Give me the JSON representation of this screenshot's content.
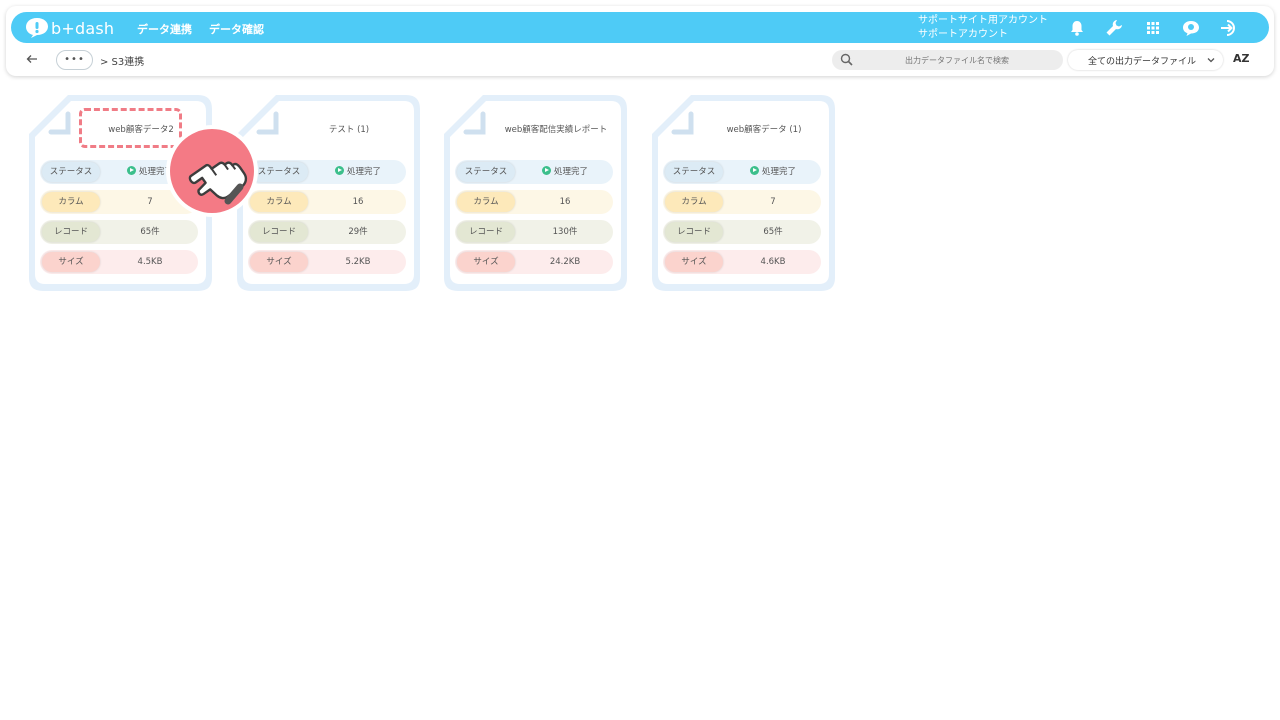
{
  "app": {
    "logo_text": "b+dash"
  },
  "nav": {
    "items": [
      "データ連携",
      "データ確認"
    ]
  },
  "account": {
    "line1": "サポートサイト用アカウント",
    "line2": "サポートアカウント"
  },
  "icons": {
    "bell": "bell-icon",
    "tool": "wrench-icon",
    "apps": "grid-icon",
    "user": "user-avatar-icon",
    "logout": "logout-icon",
    "back": "arrow-left-icon",
    "search": "search-icon",
    "chevron": "chevron-down-icon"
  },
  "breadcrumb": {
    "dots": "•••",
    "path": "> S3連携"
  },
  "search": {
    "placeholder": "出力データファイル名で検索"
  },
  "filter": {
    "selected": "全ての出力データファイル"
  },
  "sort": {
    "label": "AZ"
  },
  "row_labels": {
    "status": "ステータス",
    "columns": "カラム",
    "records": "レコード",
    "size": "サイズ"
  },
  "cards": [
    {
      "title": "web顧客データ2",
      "status": "処理完了",
      "columns": "7",
      "records": "65件",
      "size": "4.5KB"
    },
    {
      "title": "テスト (1)",
      "status": "処理完了",
      "columns": "16",
      "records": "29件",
      "size": "5.2KB"
    },
    {
      "title": "web顧客配信実績レポート",
      "status": "処理完了",
      "columns": "16",
      "records": "130件",
      "size": "24.2KB"
    },
    {
      "title": "web顧客データ (1)",
      "status": "処理完了",
      "columns": "7",
      "records": "65件",
      "size": "4.6KB"
    }
  ],
  "colors": {
    "header": "#4ecbf6",
    "highlight": "#f07c86",
    "status_dot": "#3cbf8c"
  }
}
